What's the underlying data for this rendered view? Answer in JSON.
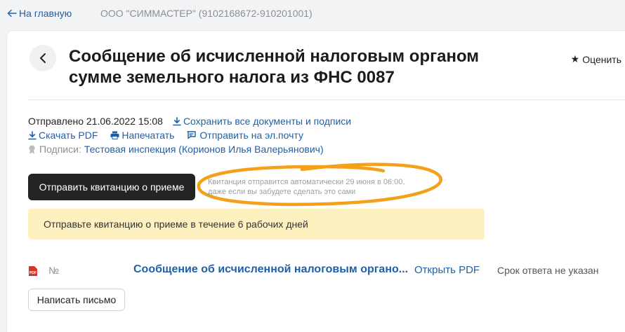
{
  "topbar": {
    "back_label": "На главную",
    "organization": "ООО \"СИММАСТЕР\" (9102168672-910201001)"
  },
  "header": {
    "title": "Сообщение об исчисленной налоговым органом сумме земельного налога из ФНС 0087",
    "rate_label": "Оценить"
  },
  "meta": {
    "sent": "Отправлено 21.06.2022 15:08",
    "save_all": "Сохранить все документы и подписи",
    "download_pdf": "Скачать PDF",
    "print": "Напечатать",
    "send_email": "Отправить на эл.почту",
    "signatures_label": "Подписи:",
    "signatures_value": "Тестовая инспекция (Корионов Илья Валерьянович)"
  },
  "action": {
    "send_receipt": "Отправить квитанцию о приеме",
    "hint_line1": "Квитанция отправится автоматически 29 июня в 06:00,",
    "hint_line2": "даже если вы забудете сделать это сами"
  },
  "notice": {
    "text": "Отправьте квитанцию о приеме в течение 6 рабочих дней"
  },
  "document": {
    "badge": "PDF",
    "number_label": "№",
    "name": "Сообщение об исчисленной налоговым органо...",
    "open_pdf": "Открыть PDF",
    "deadline": "Срок ответа не указан"
  },
  "footer": {
    "write_letter": "Написать письмо"
  },
  "colors": {
    "link": "#1f5fa8",
    "primary_button": "#242424",
    "notice_bg": "#fdf1bf",
    "annotation": "#f5a01a",
    "pdf_badge": "#d9342b"
  }
}
